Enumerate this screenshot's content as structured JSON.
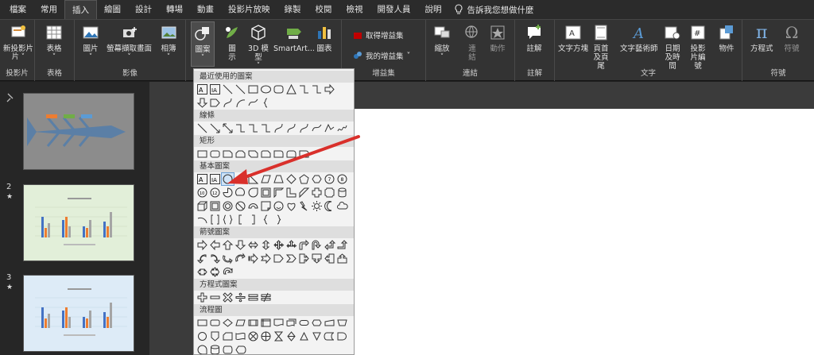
{
  "menu": {
    "tabs": [
      "檔案",
      "常用",
      "插入",
      "繪圖",
      "設計",
      "轉場",
      "動畫",
      "投影片放映",
      "錄製",
      "校閱",
      "檢視",
      "開發人員",
      "說明"
    ],
    "active_tab": "插入",
    "tell_me": "告訴我您想做什麼"
  },
  "ribbon": {
    "new_slide": "新投影片",
    "table": "表格",
    "pictures": "圖片",
    "screenshot": "螢幕擷取畫面",
    "album": "相簿",
    "shapes": "圖案",
    "icons": "圖示",
    "models_3d": "3D 模型",
    "smartart": "SmartArt...",
    "chart": "圖表",
    "get_addins": "取得增益集",
    "my_addins": "我的增益集",
    "zoom": "縮放",
    "link": "連結",
    "action": "動作",
    "comment": "註解",
    "textbox": "文字方塊",
    "header_footer": "頁首及頁尾",
    "wordart": "文字藝術師",
    "datetime": "日期及時間",
    "slide_number": "投影片編號",
    "object": "物件",
    "equation": "方程式",
    "symbol": "符號",
    "groups": {
      "slides": "投影片",
      "tables": "表格",
      "images": "影像",
      "addins": "增益集",
      "links": "連結",
      "comments": "註解",
      "text": "文字",
      "symbols": "符號"
    }
  },
  "slides": [
    {
      "num": "",
      "star": "",
      "bg": "#8c8c8c",
      "kind": "fishbone"
    },
    {
      "num": "2",
      "star": "★",
      "bg": "#e2efd9",
      "kind": "chart"
    },
    {
      "num": "3",
      "star": "★",
      "bg": "#ddebf7",
      "kind": "chart"
    }
  ],
  "shapes_menu": {
    "sections": [
      "最近使用的圖案",
      "線條",
      "矩形",
      "基本圖案",
      "箭號圖案",
      "方程式圖案",
      "流程圖"
    ]
  },
  "colors": {
    "accent_arrow": "#d9302b",
    "chart_blue": "#4472c4",
    "chart_orange": "#ed7d31",
    "chart_gray": "#a5a5a5"
  }
}
